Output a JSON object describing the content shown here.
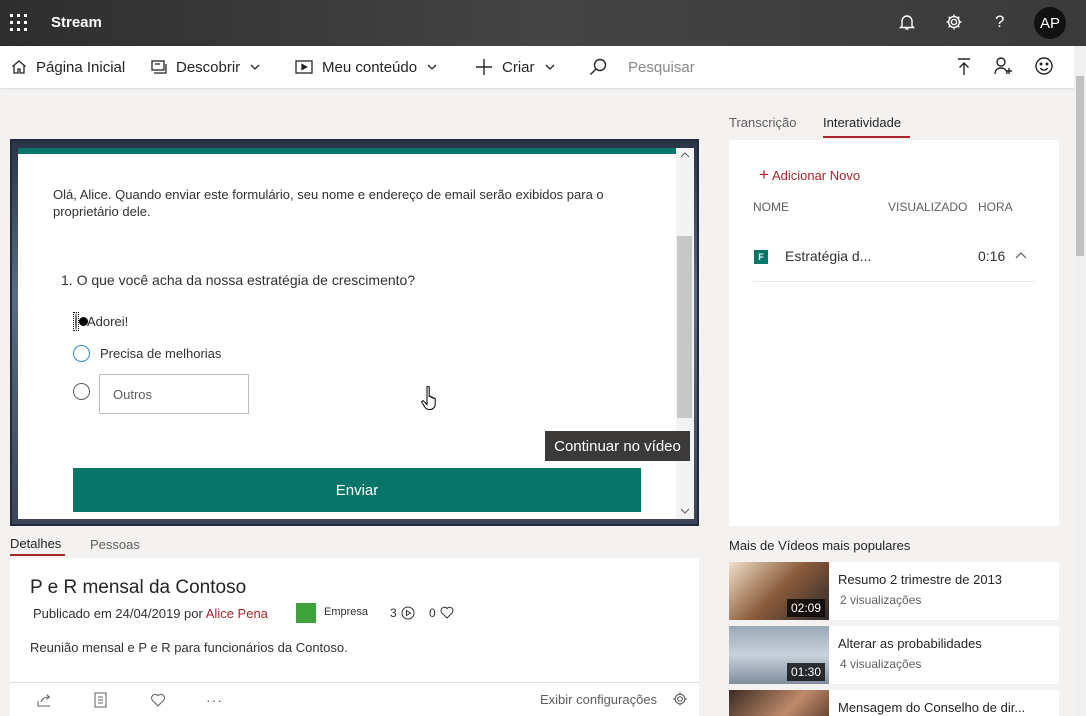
{
  "app": {
    "title": "Stream",
    "avatar_initials": "AP"
  },
  "nav": {
    "home": "Página Inicial",
    "discover": "Descobrir",
    "my_content": "Meu conteúdo",
    "create": "Criar",
    "search_placeholder": "Pesquisar"
  },
  "form": {
    "intro": "Olá, Alice. Quando enviar este formulário, seu nome e endereço de email serão exibidos para o proprietário dele.",
    "question": "1. O que você acha da nossa estratégia de crescimento?",
    "options": [
      "Adorei!",
      "Precisa de melhorias"
    ],
    "selected_option": "Adorei!",
    "other_placeholder": "Outros",
    "submit": "Enviar",
    "accent_color": "#077568"
  },
  "video": {
    "continue_label": "Continuar no vídeo"
  },
  "details": {
    "tabs": [
      "Detalhes",
      "Pessoas"
    ],
    "active_tab": "Detalhes",
    "title": "P e R mensal da Contoso",
    "published_prefix": "Publicado em 24/04/2019 por",
    "author": "Alice Pena",
    "group": "Empresa",
    "views": "3",
    "likes": "0",
    "description": "Reunião mensal e P e R para funcionários da Contoso.",
    "settings_label": "Exibir configurações"
  },
  "right_panel": {
    "tabs": [
      "Transcrição",
      "Interatividade"
    ],
    "active_tab": "Interatividade",
    "add_new": "Adicionar Novo",
    "columns": [
      "NOME",
      "VISUALIZADO",
      "HORA"
    ],
    "rows": [
      {
        "name": "Estratégia d...",
        "time": "0:16"
      }
    ]
  },
  "popular": {
    "title": "Mais de Vídeos mais populares",
    "videos": [
      {
        "title": "Resumo 2 trimestre de 2013",
        "views": "2 visualizações",
        "duration": "02:09"
      },
      {
        "title": "Alterar as probabilidades",
        "views": "4 visualizações",
        "duration": "01:30"
      },
      {
        "title": "Mensagem do Conselho de dir...",
        "views": "",
        "duration": ""
      }
    ]
  }
}
